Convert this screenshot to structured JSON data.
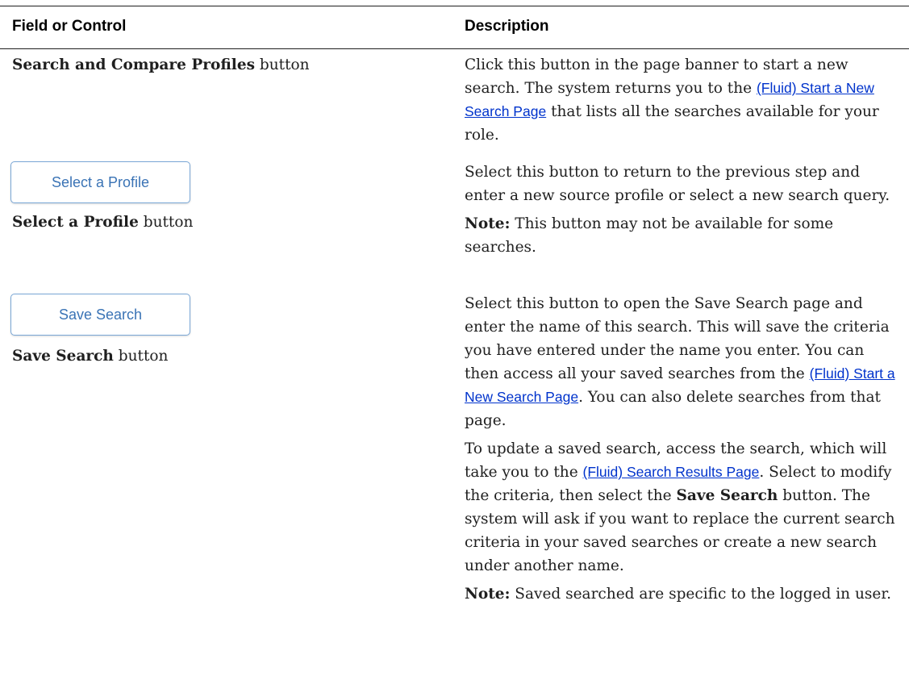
{
  "headers": {
    "field": "Field or Control",
    "description": "Description"
  },
  "rows": [
    {
      "field_bold": "Search and Compare Profiles",
      "field_rest": " button",
      "desc": {
        "p1_a": "Click this button in the page banner to start a new search. The system returns you to the ",
        "p1_link": "(Fluid) Start a New Search Page",
        "p1_b": " that lists all the searches available for your role."
      }
    },
    {
      "button_label": "Select a Profile",
      "field_bold": "Select a Profile",
      "field_rest": " button",
      "desc": {
        "p1": "Select this button to return to the previous step and enter a new source profile or select a new search query.",
        "note_label": "Note:",
        "note_text": " This button may not be available for some searches."
      }
    },
    {
      "button_label": "Save Search",
      "field_bold": "Save Search",
      "field_rest": " button",
      "desc": {
        "p1_a": "Select this button to open the Save Search page and enter the name of this search. This will save the criteria you have entered under the name you enter. You can then access all your saved searches from the ",
        "p1_link": "(Fluid) Start a New Search Page",
        "p1_b": ". You can also delete searches from that page.",
        "p2_a": "To update a saved search, access the search, which will take you to the ",
        "p2_link": "(Fluid) Search Results Page",
        "p2_b": ". Select to modify the criteria, then select the ",
        "p2_bold": "Save Search",
        "p2_c": " button. The system will ask if you want to replace the current search criteria in your saved searches or create a new search under another name.",
        "note_label": "Note:",
        "note_text": " Saved searched are specific to the logged in user."
      }
    }
  ]
}
